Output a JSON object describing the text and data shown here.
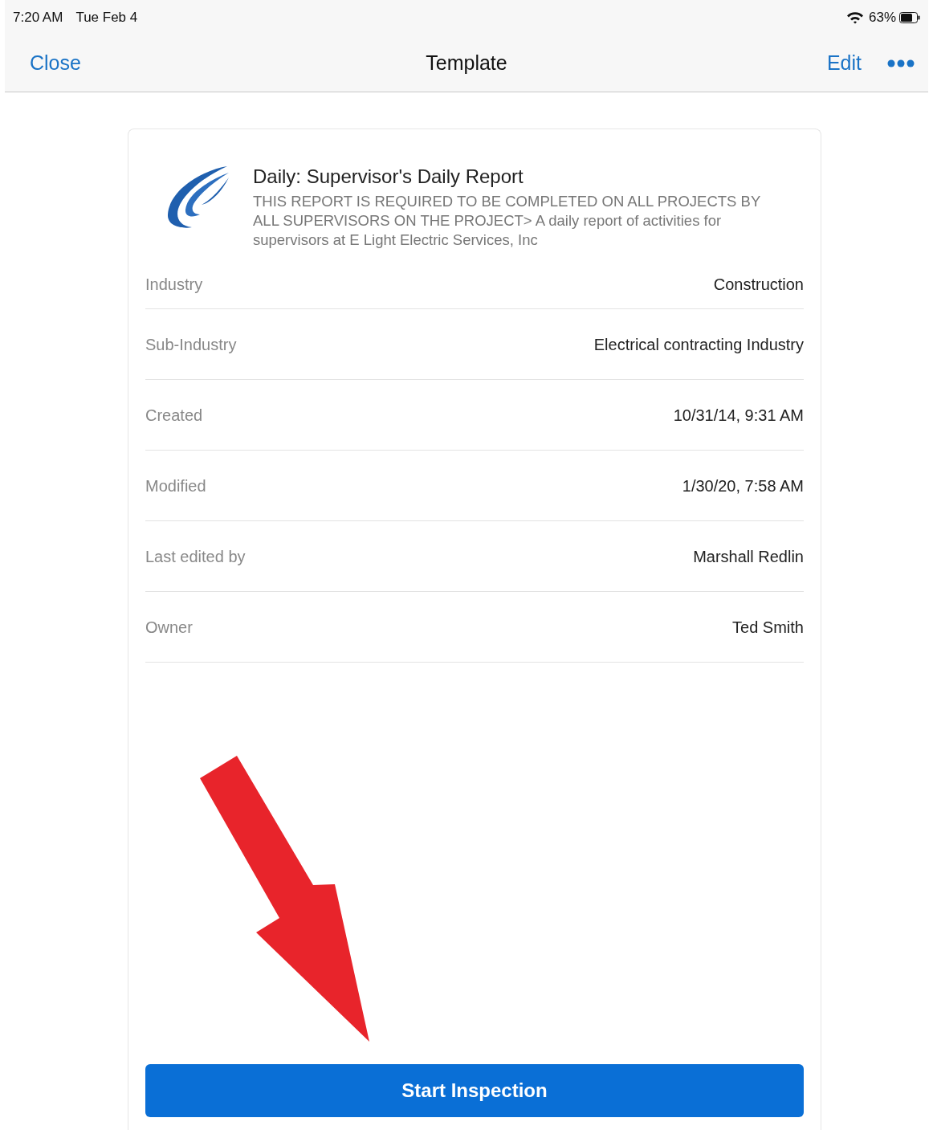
{
  "status_bar": {
    "time": "7:20 AM",
    "date": "Tue Feb 4",
    "battery": "63%"
  },
  "nav_bar": {
    "left": "Close",
    "title": "Template",
    "right": "Edit"
  },
  "template": {
    "title": "Daily: Supervisor's Daily Report",
    "description": "THIS REPORT IS REQUIRED TO BE COMPLETED ON ALL PROJECTS BY ALL SUPERVISORS ON THE PROJECT> A daily report of activities for supervisors at E Light Electric Services, Inc"
  },
  "details": [
    {
      "label": "Industry",
      "value": "Construction"
    },
    {
      "label": "Sub-Industry",
      "value": "Electrical contracting Industry"
    },
    {
      "label": "Created",
      "value": "10/31/14, 9:31 AM"
    },
    {
      "label": "Modified",
      "value": "1/30/20, 7:58 AM"
    },
    {
      "label": "Last edited by",
      "value": "Marshall Redlin"
    },
    {
      "label": "Owner",
      "value": "Ted Smith"
    }
  ],
  "primary_button": "Start Inspection"
}
